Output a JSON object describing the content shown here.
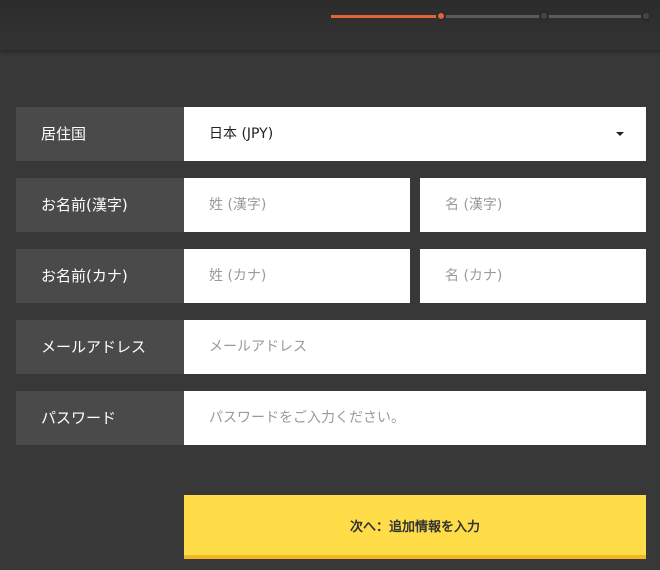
{
  "progress": {
    "steps_total": 3,
    "current_step": 1
  },
  "form": {
    "country": {
      "label": "居住国",
      "selected_value": "日本 (JPY)"
    },
    "name_kanji": {
      "label": "お名前(漢字)",
      "last_placeholder": "姓 (漢字)",
      "first_placeholder": "名 (漢字)"
    },
    "name_kana": {
      "label": "お名前(カナ)",
      "last_placeholder": "姓 (カナ)",
      "first_placeholder": "名 (カナ)"
    },
    "email": {
      "label": "メールアドレス",
      "placeholder": "メールアドレス"
    },
    "password": {
      "label": "パスワード",
      "placeholder": "パスワードをご入力ください。"
    }
  },
  "next_button": {
    "label": "次へ：追加情報を入力"
  },
  "colors": {
    "background": "#383838",
    "label_bg": "#4a4a4a",
    "accent": "#e0633a",
    "button": "#fedd48"
  }
}
